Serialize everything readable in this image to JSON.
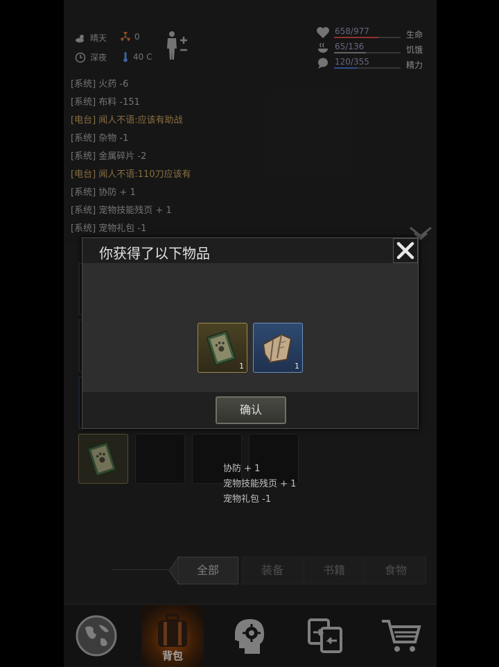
{
  "header": {
    "weather": "晴天",
    "radiation": "0",
    "time_of_day": "深夜",
    "temperature": "40 C",
    "stats": [
      {
        "name": "生命",
        "value": "658/977",
        "fraction": 0.67,
        "color": "#b33a3a",
        "icon": "heart-icon"
      },
      {
        "name": "饥饿",
        "value": "65/136",
        "fraction": 0.48,
        "color": "#7a7a7a",
        "icon": "food-icon"
      },
      {
        "name": "精力",
        "value": "120/355",
        "fraction": 0.34,
        "color": "#3a5fae",
        "icon": "energy-icon"
      }
    ]
  },
  "log": [
    {
      "tag": "[系统]",
      "text": " 火药 -6",
      "type": "system"
    },
    {
      "tag": "[系统]",
      "text": " 布料 -151",
      "type": "system"
    },
    {
      "tag": "[电台]",
      "text": " 闻人不语:应该有助战",
      "type": "radio"
    },
    {
      "tag": "[系统]",
      "text": " 杂物 -1",
      "type": "system"
    },
    {
      "tag": "[系统]",
      "text": " 金属碎片 -2",
      "type": "system"
    },
    {
      "tag": "[电台]",
      "text": " 闻人不语:110刀应该有",
      "type": "radio"
    },
    {
      "tag": "[系统]",
      "text": " 协防 + 1",
      "type": "system"
    },
    {
      "tag": "[系统]",
      "text": " 宠物技能残页 + 1",
      "type": "system"
    },
    {
      "tag": "[系统]",
      "text": " 宠物礼包 -1",
      "type": "system"
    }
  ],
  "floating_messages": [
    "协防 + 1",
    "宠物技能残页 + 1",
    "宠物礼包 -1"
  ],
  "popup": {
    "title": "你获得了以下物品",
    "items": [
      {
        "name": "pet-gift-book",
        "count": "1"
      },
      {
        "name": "pet-skill-page",
        "count": "1"
      }
    ],
    "confirm_label": "确认"
  },
  "tabs": [
    "全部",
    "装备",
    "书籍",
    "食物"
  ],
  "active_tab": "全部",
  "nav": {
    "active_label": "背包"
  },
  "colors": {
    "radio": "#a8864f",
    "system": "#8e8e8e",
    "accent": "#9a4a10"
  }
}
